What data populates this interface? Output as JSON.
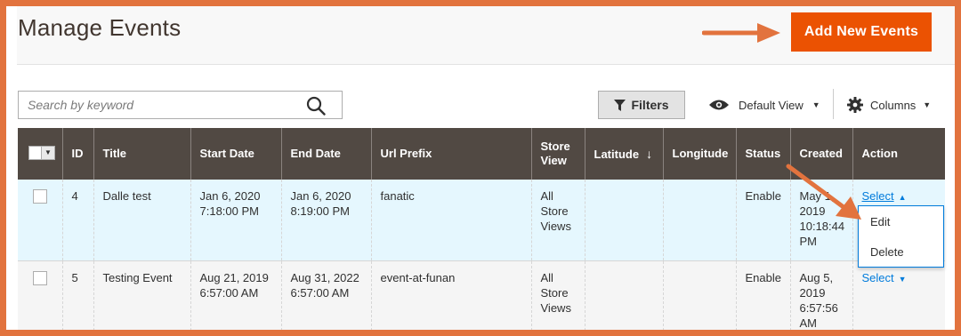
{
  "header": {
    "title": "Manage Events",
    "add_button": "Add New Events"
  },
  "toolbar": {
    "search_placeholder": "Search by keyword",
    "filters": "Filters",
    "view": "Default View",
    "columns": "Columns"
  },
  "grid": {
    "columns": [
      "ID",
      "Title",
      "Start Date",
      "End Date",
      "Url Prefix",
      "Store View",
      "Latitude",
      "Longitude",
      "Status",
      "Created",
      "Action"
    ],
    "rows": [
      {
        "id": "4",
        "title": "Dalle test",
        "start_date": "Jan 6, 2020 7:18:00 PM",
        "end_date": "Jan 6, 2020 8:19:00 PM",
        "url_prefix": "fanatic",
        "store_view": "All Store Views",
        "latitude": "",
        "longitude": "",
        "status": "Enable",
        "created": "May 1, 2019 10:18:44 PM",
        "action": "Select"
      },
      {
        "id": "5",
        "title": "Testing Event",
        "start_date": "Aug 21, 2019 6:57:00 AM",
        "end_date": "Aug 31, 2022 6:57:00 AM",
        "url_prefix": "event-at-funan",
        "store_view": "All Store Views",
        "latitude": "",
        "longitude": "",
        "status": "Enable",
        "created": "Aug 5, 2019 6:57:56 AM",
        "action": "Select"
      }
    ],
    "action_menu": [
      "Edit",
      "Delete"
    ]
  },
  "colors": {
    "accent": "#eb5202",
    "header_bg": "#514943",
    "link": "#007bdb",
    "frame": "#e2733e"
  }
}
